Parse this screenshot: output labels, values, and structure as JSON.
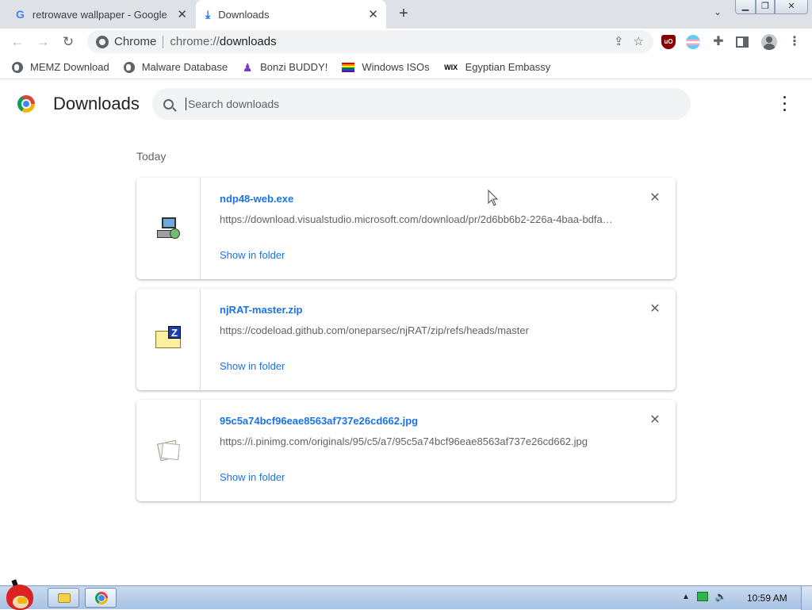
{
  "browser": {
    "tabs": [
      {
        "title": "retrowave wallpaper - Google",
        "icon": "google-g-icon"
      },
      {
        "title": "Downloads",
        "icon": "download-arrow-icon"
      }
    ],
    "omnibox": {
      "site_label": "Chrome",
      "url_scheme": "chrome://",
      "url_path": "downloads"
    },
    "bookmarks": [
      {
        "label": "MEMZ Download",
        "icon": "globe-icon"
      },
      {
        "label": "Malware Database",
        "icon": "globe-icon"
      },
      {
        "label": "Bonzi BUDDY!",
        "icon": "bonzi-icon"
      },
      {
        "label": "Windows ISOs",
        "icon": "rainbow-flag-icon"
      },
      {
        "label": "Egyptian Embassy",
        "icon": "wix-icon",
        "icon_text": "WIX"
      }
    ],
    "ublock_label": "uO"
  },
  "downloads_page": {
    "title": "Downloads",
    "search_placeholder": "Search downloads",
    "date_heading": "Today",
    "items": [
      {
        "filename": "ndp48-web.exe",
        "url": "https://download.visualstudio.microsoft.com/download/pr/2d6bb6b2-226a-4baa-bdfa-…",
        "action": "Show in folder"
      },
      {
        "filename": "njRAT-master.zip",
        "url": "https://codeload.github.com/oneparsec/njRAT/zip/refs/heads/master",
        "action": "Show in folder"
      },
      {
        "filename": "95c5a74bcf96eae8563af737e26cd662.jpg",
        "url": "https://i.pinimg.com/originals/95/c5/a7/95c5a74bcf96eae8563af737e26cd662.jpg",
        "action": "Show in folder"
      }
    ]
  },
  "taskbar": {
    "clock": "10:59 AM",
    "zip_letter": "Z"
  },
  "colors": {
    "link": "#1a73e8",
    "tabstrip": "#dee1e6",
    "taskbar": "#a7c2e3"
  }
}
